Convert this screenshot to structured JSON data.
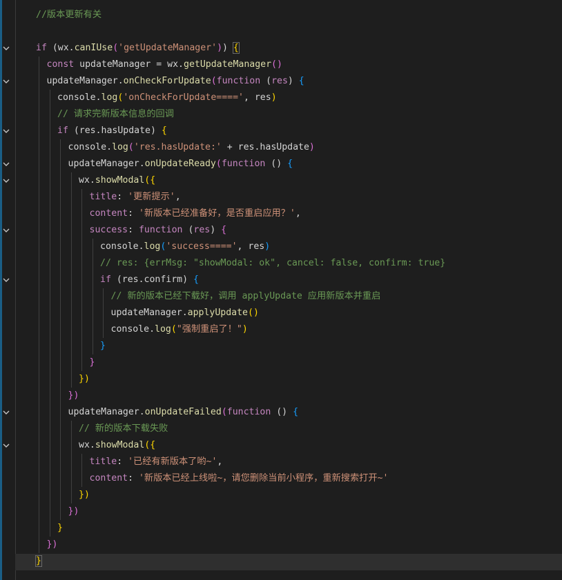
{
  "editor": {
    "language": "javascript",
    "theme": "dark",
    "lines": [
      {
        "indent": 0,
        "tokens": [
          {
            "t": "//版本更新有关",
            "c": "cm"
          }
        ]
      },
      {
        "indent": 0,
        "tokens": []
      },
      {
        "indent": 0,
        "fold": true,
        "tokens": [
          {
            "t": "if",
            "c": "kw"
          },
          {
            "t": " ("
          },
          {
            "t": "wx."
          },
          {
            "t": "canIUse",
            "c": "fn"
          },
          {
            "t": "(",
            "c": "b2"
          },
          {
            "t": "'getUpdateManager'",
            "c": "str"
          },
          {
            "t": ")",
            "c": "b2"
          },
          {
            "t": ") "
          },
          {
            "t": "{",
            "c": "b1",
            "match": true
          }
        ]
      },
      {
        "indent": 1,
        "tokens": [
          {
            "t": "const",
            "c": "kw"
          },
          {
            "t": " updateManager = wx."
          },
          {
            "t": "getUpdateManager",
            "c": "fn"
          },
          {
            "t": "()",
            "c": "b2"
          }
        ]
      },
      {
        "indent": 1,
        "fold": true,
        "tokens": [
          {
            "t": "updateManager."
          },
          {
            "t": "onCheckForUpdate",
            "c": "fn"
          },
          {
            "t": "(",
            "c": "b2"
          },
          {
            "t": "function",
            "c": "kw"
          },
          {
            "t": " ("
          },
          {
            "t": "res",
            "c": "kw"
          },
          {
            "t": ") "
          },
          {
            "t": "{",
            "c": "b3"
          }
        ]
      },
      {
        "indent": 2,
        "tokens": [
          {
            "t": "console."
          },
          {
            "t": "log",
            "c": "fn"
          },
          {
            "t": "(",
            "c": "b1"
          },
          {
            "t": "'onCheckForUpdate===='",
            "c": "str"
          },
          {
            "t": ", res"
          },
          {
            "t": ")",
            "c": "b1"
          }
        ]
      },
      {
        "indent": 2,
        "tokens": [
          {
            "t": "// 请求完新版本信息的回调",
            "c": "cm"
          }
        ]
      },
      {
        "indent": 2,
        "fold": true,
        "tokens": [
          {
            "t": "if",
            "c": "kw"
          },
          {
            "t": " (res.hasUpdate) "
          },
          {
            "t": "{",
            "c": "b1"
          }
        ]
      },
      {
        "indent": 3,
        "tokens": [
          {
            "t": "console."
          },
          {
            "t": "log",
            "c": "fn"
          },
          {
            "t": "(",
            "c": "b2"
          },
          {
            "t": "'res.hasUpdate:'",
            "c": "str"
          },
          {
            "t": " + res.hasUpdate"
          },
          {
            "t": ")",
            "c": "b2"
          }
        ]
      },
      {
        "indent": 3,
        "fold": true,
        "tokens": [
          {
            "t": "updateManager."
          },
          {
            "t": "onUpdateReady",
            "c": "fn"
          },
          {
            "t": "(",
            "c": "b2"
          },
          {
            "t": "function",
            "c": "kw"
          },
          {
            "t": " () "
          },
          {
            "t": "{",
            "c": "b3"
          }
        ]
      },
      {
        "indent": 4,
        "fold": true,
        "tokens": [
          {
            "t": "wx."
          },
          {
            "t": "showModal",
            "c": "fn"
          },
          {
            "t": "({",
            "c": "b1"
          }
        ]
      },
      {
        "indent": 5,
        "tokens": [
          {
            "t": "title",
            "c": "kw"
          },
          {
            "t": ": "
          },
          {
            "t": "'更新提示'",
            "c": "str"
          },
          {
            "t": ","
          }
        ]
      },
      {
        "indent": 5,
        "tokens": [
          {
            "t": "content",
            "c": "kw"
          },
          {
            "t": ": "
          },
          {
            "t": "'新版本已经准备好，是否重启应用？'",
            "c": "str"
          },
          {
            "t": ","
          }
        ]
      },
      {
        "indent": 5,
        "fold": true,
        "tokens": [
          {
            "t": "success",
            "c": "kw"
          },
          {
            "t": ": "
          },
          {
            "t": "function",
            "c": "kw"
          },
          {
            "t": " ("
          },
          {
            "t": "res",
            "c": "kw"
          },
          {
            "t": ") "
          },
          {
            "t": "{",
            "c": "b2"
          }
        ]
      },
      {
        "indent": 6,
        "tokens": [
          {
            "t": "console."
          },
          {
            "t": "log",
            "c": "fn"
          },
          {
            "t": "(",
            "c": "b3"
          },
          {
            "t": "'success===='",
            "c": "str"
          },
          {
            "t": ", res"
          },
          {
            "t": ")",
            "c": "b3"
          }
        ]
      },
      {
        "indent": 6,
        "tokens": [
          {
            "t": "// res: {errMsg: \"showModal: ok\", cancel: false, confirm: true}",
            "c": "cm"
          }
        ]
      },
      {
        "indent": 6,
        "fold": true,
        "tokens": [
          {
            "t": "if",
            "c": "kw"
          },
          {
            "t": " (res.confirm) "
          },
          {
            "t": "{",
            "c": "b3"
          }
        ]
      },
      {
        "indent": 7,
        "tokens": [
          {
            "t": "// 新的版本已经下载好，调用 applyUpdate 应用新版本并重启",
            "c": "cm"
          }
        ]
      },
      {
        "indent": 7,
        "tokens": [
          {
            "t": "updateManager."
          },
          {
            "t": "applyUpdate",
            "c": "fn"
          },
          {
            "t": "()",
            "c": "b1"
          }
        ]
      },
      {
        "indent": 7,
        "tokens": [
          {
            "t": "console."
          },
          {
            "t": "log",
            "c": "fn"
          },
          {
            "t": "(",
            "c": "b1"
          },
          {
            "t": "\"强制重启了！\"",
            "c": "str"
          },
          {
            "t": ")",
            "c": "b1"
          }
        ]
      },
      {
        "indent": 6,
        "tokens": [
          {
            "t": "}",
            "c": "b3"
          }
        ]
      },
      {
        "indent": 5,
        "tokens": [
          {
            "t": "}",
            "c": "b2"
          }
        ]
      },
      {
        "indent": 4,
        "tokens": [
          {
            "t": "})",
            "c": "b1"
          }
        ]
      },
      {
        "indent": 3,
        "tokens": [
          {
            "t": "})",
            "c": "b2"
          }
        ]
      },
      {
        "indent": 3,
        "fold": true,
        "tokens": [
          {
            "t": "updateManager."
          },
          {
            "t": "onUpdateFailed",
            "c": "fn"
          },
          {
            "t": "(",
            "c": "b2"
          },
          {
            "t": "function",
            "c": "kw"
          },
          {
            "t": " () "
          },
          {
            "t": "{",
            "c": "b3"
          }
        ]
      },
      {
        "indent": 4,
        "tokens": [
          {
            "t": "// 新的版本下载失败",
            "c": "cm"
          }
        ]
      },
      {
        "indent": 4,
        "fold": true,
        "tokens": [
          {
            "t": "wx."
          },
          {
            "t": "showModal",
            "c": "fn"
          },
          {
            "t": "({",
            "c": "b1"
          }
        ]
      },
      {
        "indent": 5,
        "tokens": [
          {
            "t": "title",
            "c": "kw"
          },
          {
            "t": ": "
          },
          {
            "t": "'已经有新版本了哟~'",
            "c": "str"
          },
          {
            "t": ","
          }
        ]
      },
      {
        "indent": 5,
        "tokens": [
          {
            "t": "content",
            "c": "kw"
          },
          {
            "t": ": "
          },
          {
            "t": "'新版本已经上线啦~，请您删除当前小程序，重新搜索打开~'",
            "c": "str"
          }
        ]
      },
      {
        "indent": 4,
        "tokens": [
          {
            "t": "})",
            "c": "b1"
          }
        ]
      },
      {
        "indent": 3,
        "tokens": [
          {
            "t": "})",
            "c": "b2"
          }
        ]
      },
      {
        "indent": 2,
        "tokens": [
          {
            "t": "}",
            "c": "b1"
          }
        ]
      },
      {
        "indent": 1,
        "tokens": [
          {
            "t": "})",
            "c": "b2"
          }
        ]
      },
      {
        "indent": 0,
        "current": true,
        "tokens": [
          {
            "t": "}",
            "c": "b1",
            "match": true
          }
        ]
      }
    ]
  }
}
